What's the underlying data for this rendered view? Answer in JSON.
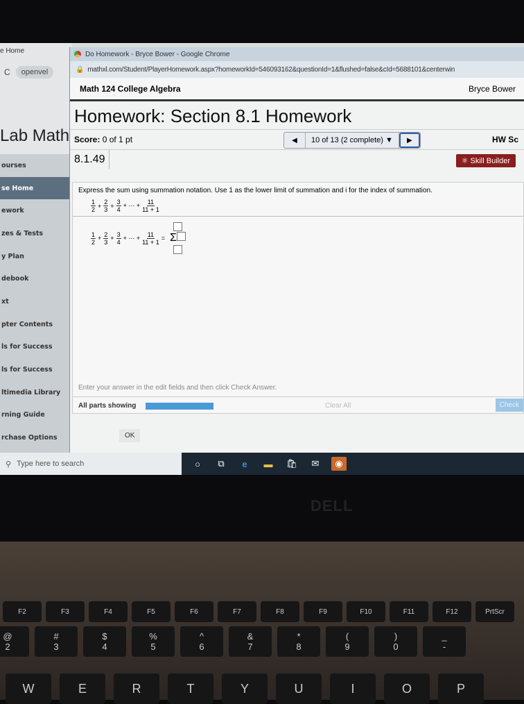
{
  "background_window": {
    "tab": "e Home",
    "address": "openvel",
    "brand": "Lab Math",
    "sidebar": [
      "ourses",
      "se Home",
      "ework",
      "zes & Tests",
      "y Plan",
      "debook",
      "xt",
      "pter Contents",
      "ls for Success",
      "ls for Success",
      "ltimedia Library",
      "rning Guide",
      "rchase Options"
    ]
  },
  "window": {
    "title": "Do Homework - Bryce Bower - Google Chrome",
    "url": "mathxl.com/Student/PlayerHomework.aspx?homeworkId=546093162&questionId=1&flushed=false&cId=5688101&centerwin"
  },
  "course": {
    "name": "Math 124 College Algebra",
    "user": "Bryce Bower"
  },
  "homework": {
    "title": "Homework: Section 8.1 Homework",
    "score_label": "Score:",
    "score": "0 of 1 pt",
    "nav": "10 of 13 (2 complete)",
    "hw_score": "HW Sc",
    "question_number": "8.1.49",
    "skill_builder": "Skill Builder"
  },
  "question": {
    "prompt": "Express the sum using summation notation. Use 1 as the lower limit of summation and i for the index of summation.",
    "terms": [
      {
        "n": "1",
        "d": "2"
      },
      {
        "n": "2",
        "d": "3"
      },
      {
        "n": "3",
        "d": "4"
      }
    ],
    "dots": "+ ⋯ +",
    "last": {
      "n": "11",
      "d": "11 + 1"
    },
    "sigma": "Σ",
    "equals": "="
  },
  "footer": {
    "hint": "Enter your answer in the edit fields and then click Check Answer.",
    "parts": "All parts showing",
    "progress": 1.0,
    "clear_all": "Clear All",
    "check": "Check",
    "ok": "OK"
  },
  "taskbar": {
    "search_placeholder": "Type here to search"
  },
  "laptop": {
    "logo": "DELL",
    "fkeys": [
      "F2",
      "F3",
      "F4",
      "F5",
      "F6",
      "F7",
      "F8",
      "F9",
      "F10",
      "F11",
      "F12",
      "PrtScr"
    ],
    "numkeys": [
      [
        "@",
        "2"
      ],
      [
        "#",
        "3"
      ],
      [
        "$",
        "4"
      ],
      [
        "%",
        "5"
      ],
      [
        "^",
        "6"
      ],
      [
        "&",
        "7"
      ],
      [
        "*",
        "8"
      ],
      [
        "(",
        "9"
      ],
      [
        ")",
        "0"
      ],
      [
        "_",
        "-"
      ]
    ],
    "letters": [
      "W",
      "E",
      "R",
      "T",
      "Y",
      "U",
      "I",
      "O",
      "P"
    ]
  },
  "colors": {
    "skill_builder": "#8a1e1e",
    "progress": "#4a9ad8",
    "taskbar": "#1b2733"
  }
}
